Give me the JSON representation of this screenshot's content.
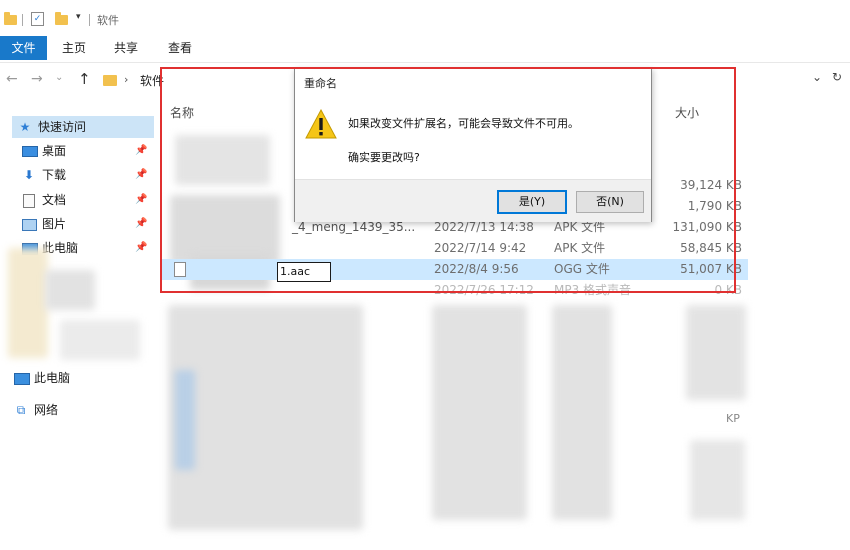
{
  "window": {
    "title": "软件"
  },
  "ribbon": {
    "tabs": [
      "文件",
      "主页",
      "共享",
      "查看"
    ]
  },
  "address": {
    "path": "软件",
    "refresh_glyph": "↻"
  },
  "sidebar": {
    "quick_access": "快速访问",
    "items": [
      {
        "label": "桌面",
        "icon": "desktop-icon"
      },
      {
        "label": "下载",
        "icon": "download-icon"
      },
      {
        "label": "文档",
        "icon": "document-icon"
      },
      {
        "label": "图片",
        "icon": "pictures-icon"
      },
      {
        "label": "此电脑",
        "icon": "computer-icon"
      }
    ],
    "this_pc": "此电脑",
    "network": "网络"
  },
  "file_list": {
    "columns": {
      "name": "名称",
      "size": "大小"
    },
    "rows": [
      {
        "name": "",
        "date": "",
        "type": "",
        "size": "39,124 KB"
      },
      {
        "name": "",
        "date": "",
        "type": "",
        "size": "1,790 KB"
      },
      {
        "name": "_4_meng_1439_35...",
        "date": "2022/7/13 14:38",
        "type": "APK 文件",
        "size": "131,090 KB"
      },
      {
        "name": "",
        "date": "2022/7/14 9:42",
        "type": "APK 文件",
        "size": "58,845 KB"
      },
      {
        "name": "1.aac",
        "date": "2022/8/4 9:56",
        "type": "OGG 文件",
        "size": "51,007 KB"
      },
      {
        "name": "",
        "date": "2022/7/26 17:12",
        "type": "MP3 格式声音",
        "size": "0 KB"
      }
    ],
    "extra_size": "KP"
  },
  "dialog": {
    "title": "重命名",
    "message": "如果改变文件扩展名，可能会导致文件不可用。",
    "question": "确实要更改吗?",
    "yes_label": "是(Y)",
    "no_label": "否(N)",
    "icon": "warning-icon"
  },
  "colors": {
    "accent": "#1979ca",
    "selection": "#cce8ff",
    "highlight_outline": "#e03030",
    "warning": "#f5c518"
  }
}
